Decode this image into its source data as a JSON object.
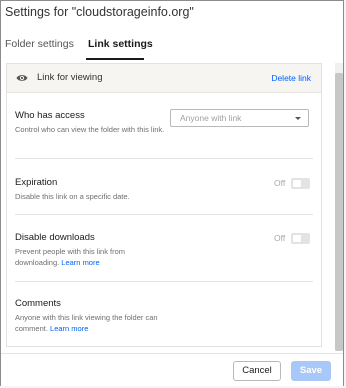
{
  "dialog": {
    "title": "Settings for \"cloudstorageinfo.org\""
  },
  "tabs": [
    {
      "label": "Folder settings",
      "active": false
    },
    {
      "label": "Link settings",
      "active": true
    }
  ],
  "link": {
    "icon": "eye-icon",
    "label": "Link for viewing",
    "delete_label": "Delete link"
  },
  "access": {
    "title": "Who has access",
    "description": "Control who can view the folder with this link.",
    "select_value": "Anyone with link"
  },
  "expiration": {
    "title": "Expiration",
    "description": "Disable this link on a specific date.",
    "state": "Off"
  },
  "downloads": {
    "title": "Disable downloads",
    "description": "Prevent people with this link from downloading.",
    "learn_more": "Learn more",
    "state": "Off"
  },
  "comments": {
    "title": "Comments",
    "description": "Anyone with this link viewing the folder can comment.",
    "learn_more": "Learn more"
  },
  "footer": {
    "cancel_label": "Cancel",
    "save_label": "Save"
  },
  "colors": {
    "accent": "#0061fe",
    "save_disabled": "#a7c8f8"
  }
}
